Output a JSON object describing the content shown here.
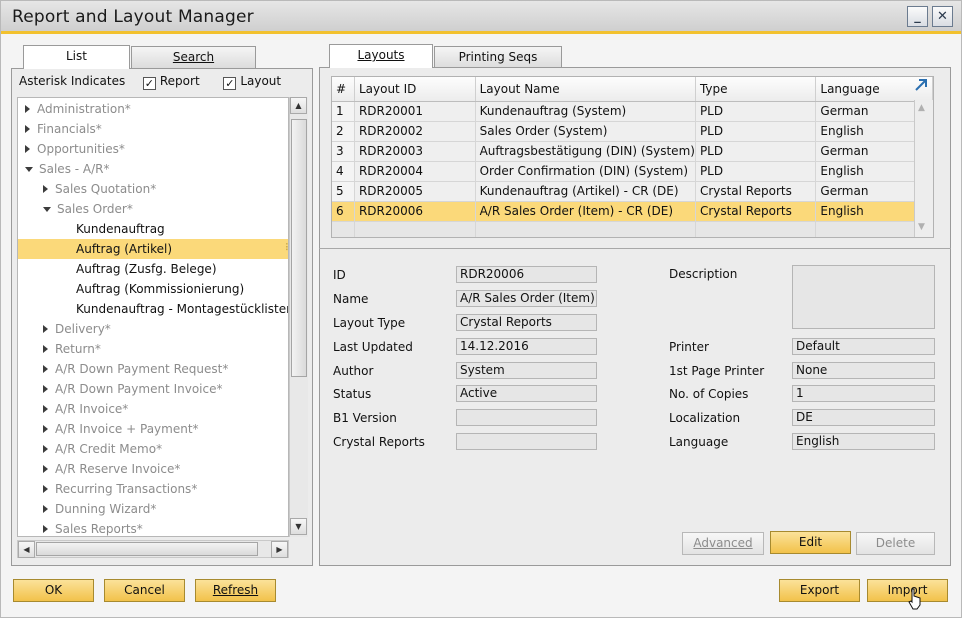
{
  "window": {
    "title": "Report and Layout Manager",
    "min_glyph": "_",
    "close_glyph": "✕"
  },
  "left_tabs": [
    {
      "label": "List",
      "active": true
    },
    {
      "label": "Search",
      "active": false
    }
  ],
  "asterisk": {
    "label": "Asterisk Indicates",
    "report_label": "Report",
    "layout_label": "Layout",
    "report_checked": "✓",
    "layout_checked": "✓"
  },
  "tree": [
    {
      "label": "Administration*",
      "level": 0,
      "arrow": "right",
      "style": "gray"
    },
    {
      "label": "Financials*",
      "level": 0,
      "arrow": "right",
      "style": "gray"
    },
    {
      "label": "Opportunities*",
      "level": 0,
      "arrow": "right",
      "style": "gray"
    },
    {
      "label": "Sales - A/R*",
      "level": 0,
      "arrow": "down",
      "style": "gray"
    },
    {
      "label": "Sales Quotation*",
      "level": 1,
      "arrow": "right",
      "style": "gray"
    },
    {
      "label": "Sales Order*",
      "level": 1,
      "arrow": "down",
      "style": "gray"
    },
    {
      "label": "Kundenauftrag",
      "level": 2,
      "arrow": "none",
      "style": "normal"
    },
    {
      "label": "Auftrag (Artikel)",
      "level": 2,
      "arrow": "none",
      "style": "selected"
    },
    {
      "label": "Auftrag (Zusfg. Belege)",
      "level": 2,
      "arrow": "none",
      "style": "normal"
    },
    {
      "label": "Auftrag (Kommissionierung)",
      "level": 2,
      "arrow": "none",
      "style": "normal"
    },
    {
      "label": "Kundenauftrag - Montagestücklistenbe",
      "level": 2,
      "arrow": "none",
      "style": "normal"
    },
    {
      "label": "Delivery*",
      "level": 1,
      "arrow": "right",
      "style": "gray"
    },
    {
      "label": "Return*",
      "level": 1,
      "arrow": "right",
      "style": "gray"
    },
    {
      "label": "A/R Down Payment Request*",
      "level": 1,
      "arrow": "right",
      "style": "gray"
    },
    {
      "label": "A/R Down Payment Invoice*",
      "level": 1,
      "arrow": "right",
      "style": "gray"
    },
    {
      "label": "A/R Invoice*",
      "level": 1,
      "arrow": "right",
      "style": "gray"
    },
    {
      "label": "A/R Invoice + Payment*",
      "level": 1,
      "arrow": "right",
      "style": "gray"
    },
    {
      "label": "A/R Credit Memo*",
      "level": 1,
      "arrow": "right",
      "style": "gray"
    },
    {
      "label": "A/R Reserve Invoice*",
      "level": 1,
      "arrow": "right",
      "style": "gray"
    },
    {
      "label": "Recurring Transactions*",
      "level": 1,
      "arrow": "right",
      "style": "gray"
    },
    {
      "label": "Dunning Wizard*",
      "level": 1,
      "arrow": "right",
      "style": "gray"
    },
    {
      "label": "Sales Reports*",
      "level": 1,
      "arrow": "right",
      "style": "gray"
    }
  ],
  "right_tabs": [
    {
      "label": "Layouts",
      "active": true
    },
    {
      "label": "Printing Seqs",
      "active": false
    }
  ],
  "grid": {
    "columns": [
      "#",
      "Layout ID",
      "Layout Name",
      "Type",
      "Language"
    ],
    "rows": [
      {
        "num": "1",
        "id": "RDR20001",
        "name": "Kundenauftrag (System)",
        "type": "PLD",
        "lang": "German"
      },
      {
        "num": "2",
        "id": "RDR20002",
        "name": "Sales Order (System)",
        "type": "PLD",
        "lang": "English"
      },
      {
        "num": "3",
        "id": "RDR20003",
        "name": "Auftragsbestätigung (DIN) (System)",
        "type": "PLD",
        "lang": "German"
      },
      {
        "num": "4",
        "id": "RDR20004",
        "name": "Order Confirmation (DIN) (System)",
        "type": "PLD",
        "lang": "English"
      },
      {
        "num": "5",
        "id": "RDR20005",
        "name": "Kundenauftrag (Artikel) - CR (DE)",
        "type": "Crystal Reports",
        "lang": "German"
      },
      {
        "num": "6",
        "id": "RDR20006",
        "name": "A/R Sales Order (Item) - CR (DE)",
        "type": "Crystal Reports",
        "lang": "English"
      }
    ],
    "selected_row": 6
  },
  "details": {
    "id_label": "ID",
    "id_value": "RDR20006",
    "name_label": "Name",
    "name_value": "A/R Sales Order (Item) - CR (DE)",
    "layout_type_label": "Layout Type",
    "layout_type_value": "Crystal Reports",
    "last_updated_label": "Last Updated",
    "last_updated_value": "14.12.2016",
    "author_label": "Author",
    "author_value": "System",
    "status_label": "Status",
    "status_value": "Active",
    "b1_version_label": "B1 Version",
    "b1_version_value": "",
    "crystal_reports_label": "Crystal Reports",
    "crystal_reports_value": "",
    "description_label": "Description",
    "printer_label": "Printer",
    "printer_value": "Default",
    "first_page_printer_label": "1st Page Printer",
    "first_page_printer_value": "None",
    "copies_label": "No. of Copies",
    "copies_value": "1",
    "localization_label": "Localization",
    "localization_value": "DE",
    "language_label": "Language",
    "language_value": "English"
  },
  "buttons": {
    "advanced": "Advanced",
    "edit": "Edit",
    "delete": "Delete",
    "ok": "OK",
    "cancel": "Cancel",
    "refresh": "Refresh",
    "export": "Export",
    "import": "Import"
  },
  "colors": {
    "accent": "#f2c12e",
    "selection": "#fbd97a",
    "button_yellow": "#f6cf63"
  }
}
